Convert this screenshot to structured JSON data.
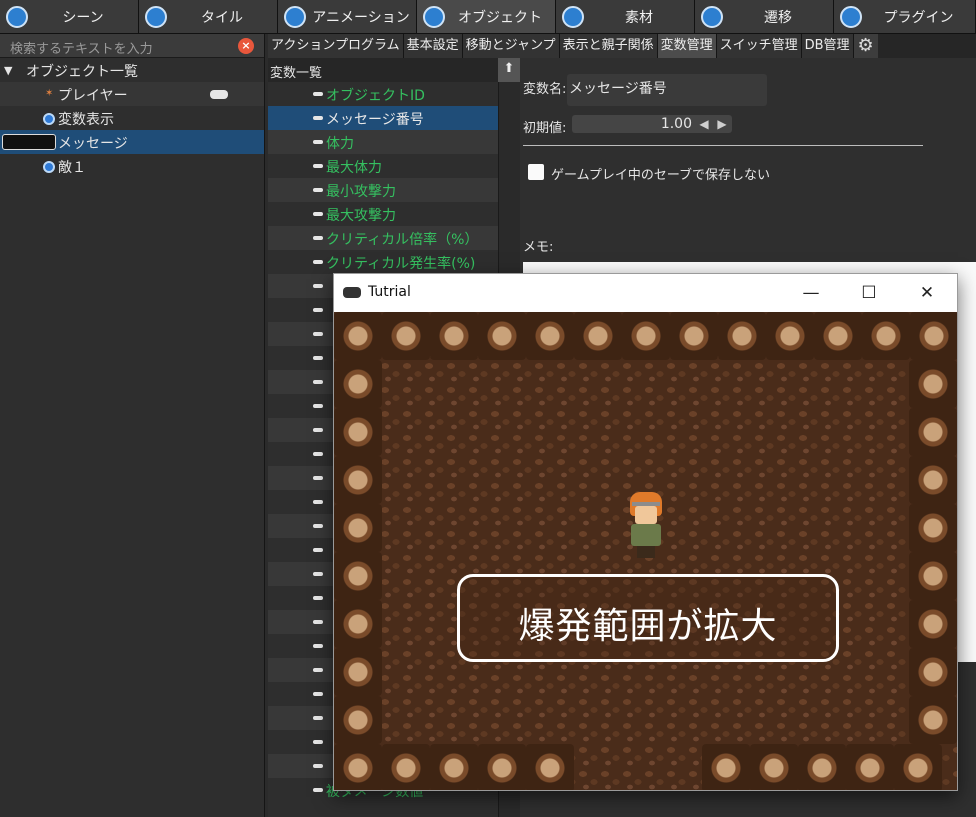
{
  "top_tabs": [
    {
      "label": "シーン",
      "icon": "scene-icon"
    },
    {
      "label": "タイル",
      "icon": "tile-icon"
    },
    {
      "label": "アニメーション",
      "icon": "animation-icon"
    },
    {
      "label": "オブジェクト",
      "icon": "object-icon"
    },
    {
      "label": "素材",
      "icon": "material-icon"
    },
    {
      "label": "遷移",
      "icon": "transition-icon"
    },
    {
      "label": "プラグイン",
      "icon": "plugin-icon"
    }
  ],
  "left_panel": {
    "search_placeholder": "検索するテキストを入力",
    "tree_root": "オブジェクト一覧",
    "items": [
      {
        "label": "プレイヤー"
      },
      {
        "label": "変数表示"
      },
      {
        "label": "メッセージ"
      },
      {
        "label": "敵１"
      }
    ]
  },
  "sub_tabs": [
    {
      "label": "アクションプログラム"
    },
    {
      "label": "基本設定"
    },
    {
      "label": "移動とジャンプ"
    },
    {
      "label": "表示と親子関係"
    },
    {
      "label": "変数管理"
    },
    {
      "label": "スイッチ管理"
    },
    {
      "label": "DB管理"
    }
  ],
  "var_list": {
    "header": "変数一覧",
    "items": [
      "オブジェクトID",
      "メッセージ番号",
      "体力",
      "最大体力",
      "最小攻撃力",
      "最大攻撃力",
      "クリティカル倍率（%）",
      "クリティカル発生率(%)",
      "被ダメージ数値"
    ]
  },
  "props": {
    "name_label": "変数名:",
    "name_value": "メッセージ番号",
    "init_label": "初期値:",
    "init_value": "1.00",
    "checkbox_label": "ゲームプレイ中のセーブで保存しない",
    "memo_label": "メモ:"
  },
  "game_window": {
    "title": "Tutrial",
    "minimize": "—",
    "maximize": "☐",
    "close": "✕",
    "message": "爆発範囲が拡大"
  }
}
